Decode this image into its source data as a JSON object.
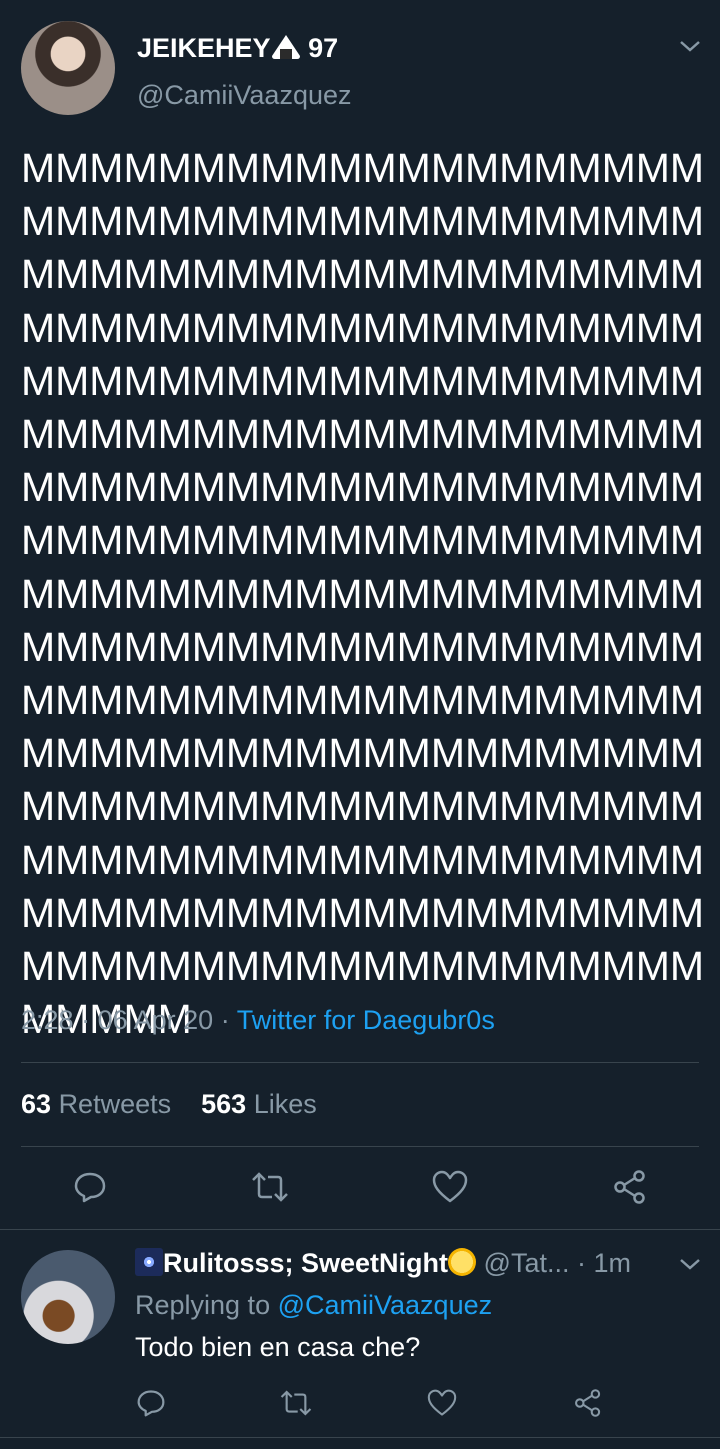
{
  "tweet": {
    "display_name": "JEIKEHEY",
    "name_suffix": "97",
    "name_emoji": "onigiri-icon",
    "handle": "@CamiiVaazquez",
    "text": "MMMMMMMMMMMMMMMMMMMMMMMMMMMMMMMMMMMMMMMMMMMMMMMMMMMMMMMMMMMMMMMMMMMMMMMMMMMMMMMMMMMMMMMMMMMMMMMMMMMMMMMMMMMMMMMMMMMMMMMMMMMMMMMMMMMMMMMMMMMMMMMMMMMMMMMMMMMMMMMMMMMMMMMMMMMMMMMMMMMMMMMMMMMMMMMMMMMMMMMMMMMMMMMMMMMMMMMMMMMMMMMMMMMMMMMMMMMMMMMMMMMMMMMMMMMMMMMMMMMMMMMMMMMMMMMMMMMMMMMMMMMMMMMMMMMMMMMMMMMMMMMMMMMMMMMMMMMMMMMMMMMMM",
    "time": "2:28",
    "date": "06 Apr 20",
    "separator": "·",
    "source": "Twitter for Daegubr0s",
    "retweets_count": "63",
    "retweets_label": "Retweets",
    "likes_count": "563",
    "likes_label": "Likes"
  },
  "reply": {
    "display_name": "Rulitosss; SweetNight",
    "name_emoji_left": "sparkler-icon",
    "name_emoji_right": "sun-icon",
    "handle": "@Tat...",
    "time": "· 1m",
    "replying_label": "Replying to",
    "replying_to": "@CamiiVaazquez",
    "text": "Todo bien en casa che?"
  },
  "colors": {
    "background": "#15202b",
    "text": "#ffffff",
    "secondary": "#8899a6",
    "accent": "#1da1f2",
    "divider": "#38444d"
  }
}
